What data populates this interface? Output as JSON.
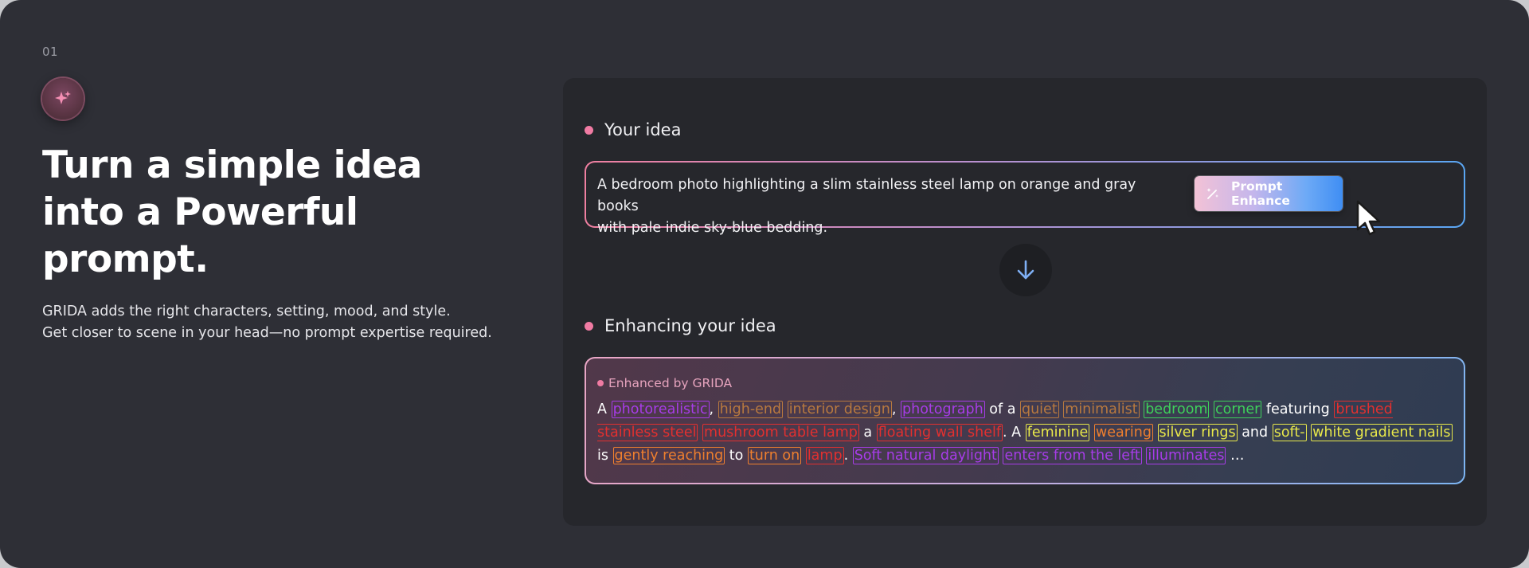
{
  "step_number": "01",
  "hero": {
    "title_lines": [
      "Turn a simple idea",
      "into a Powerful",
      "prompt."
    ],
    "description_lines": [
      "GRIDA adds the right characters, setting, mood, and style.",
      "Get closer to scene in your head—no prompt expertise required."
    ]
  },
  "idea_section": {
    "label": "Your idea",
    "text_lines": [
      "A bedroom photo highlighting a slim stainless steel lamp on orange and gray books",
      "with pale indie sky-blue bedding."
    ],
    "button_label": "Prompt Enhance",
    "button_icon": "magic-wand-icon"
  },
  "enhance_section": {
    "label": "Enhancing your idea",
    "badge_label": "Enhanced by GRIDA",
    "colors": {
      "purple": "#a73ce8",
      "brown": "#b8793f",
      "green": "#3ed15a",
      "red": "#e3302f",
      "yellow": "#e8e84a",
      "orange": "#ef7f2e"
    },
    "tokens": [
      {
        "text": "A",
        "c": "plain"
      },
      {
        "text": " ",
        "c": "sp"
      },
      {
        "text": "photorealistic",
        "c": "purple"
      },
      {
        "text": ", ",
        "c": "plain"
      },
      {
        "text": "high-end",
        "c": "brown"
      },
      {
        "text": " ",
        "c": "sp"
      },
      {
        "text": "interior design",
        "c": "brown"
      },
      {
        "text": ", ",
        "c": "plain"
      },
      {
        "text": "photograph",
        "c": "purple"
      },
      {
        "text": " of a ",
        "c": "plain"
      },
      {
        "text": "quiet",
        "c": "brown"
      },
      {
        "text": " ",
        "c": "sp"
      },
      {
        "text": "minimalist",
        "c": "brown"
      },
      {
        "text": " ",
        "c": "sp"
      },
      {
        "text": "bedroom",
        "c": "green"
      },
      {
        "text": " ",
        "c": "sp"
      },
      {
        "text": "corner",
        "c": "green"
      },
      {
        "text": " featuring ",
        "c": "plain"
      },
      {
        "text": "brushed stainless steel",
        "c": "red"
      },
      {
        "text": " ",
        "c": "sp"
      },
      {
        "text": "mushroom table lamp",
        "c": "red"
      },
      {
        "text": " a ",
        "c": "plain"
      },
      {
        "text": "floating wall shelf",
        "c": "red"
      },
      {
        "text": ". A ",
        "c": "plain"
      },
      {
        "text": "feminine",
        "c": "yellow"
      },
      {
        "text": " ",
        "c": "sp"
      },
      {
        "text": "wearing",
        "c": "orange"
      },
      {
        "text": " ",
        "c": "sp"
      },
      {
        "text": "silver rings",
        "c": "yellow"
      },
      {
        "text": " and ",
        "c": "plain"
      },
      {
        "text": "soft-",
        "c": "yellow"
      },
      {
        "text": " ",
        "c": "sp"
      },
      {
        "text": "white gradient nails",
        "c": "yellow"
      },
      {
        "text": " is ",
        "c": "plain"
      },
      {
        "text": "gently reaching",
        "c": "orange"
      },
      {
        "text": " to ",
        "c": "plain"
      },
      {
        "text": "turn on",
        "c": "orange"
      },
      {
        "text": " ",
        "c": "sp"
      },
      {
        "text": "lamp",
        "c": "red"
      },
      {
        "text": ". ",
        "c": "plain"
      },
      {
        "text": "Soft natural daylight",
        "c": "purple"
      },
      {
        "text": " ",
        "c": "sp"
      },
      {
        "text": "enters from the left",
        "c": "purple"
      },
      {
        "text": " ",
        "c": "sp"
      },
      {
        "text": "illuminates",
        "c": "purple"
      },
      {
        "text": " …",
        "c": "plain"
      }
    ]
  },
  "icons": {
    "badge": "sparkle-icon",
    "divider": "arrow-down-icon",
    "pointer": "mouse-cursor-icon"
  }
}
